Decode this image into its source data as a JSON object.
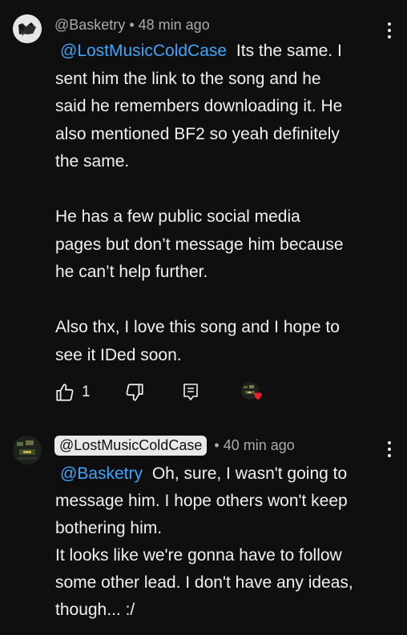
{
  "comments": [
    {
      "author": "@Basketry",
      "time": "48 min ago",
      "mention": "@LostMusicColdCase",
      "lines": [
        " Its the same. I",
        "sent him the link to the song and he",
        "said he remembers downloading it. He",
        "also mentioned BF2 so yeah definitely",
        "the same.",
        "",
        "He has a few public social media",
        "pages but don’t message him because",
        "he can’t help further.",
        "",
        "Also thx, I love this song and I hope to",
        "see it IDed soon."
      ],
      "like_count": "1"
    },
    {
      "author": "@LostMusicColdCase",
      "time": "40 min ago",
      "mention": "@Basketry",
      "lines": [
        " Oh, sure, I wasn't going to",
        "message him. I hope others won't keep",
        "bothering him.",
        "It looks like we're gonna have to follow",
        "some other lead. I don't have any ideas,",
        "though... :/"
      ]
    }
  ],
  "separator": "•",
  "icons": {
    "like": "thumbs-up-icon",
    "dislike": "thumbs-down-icon",
    "reply": "reply-icon",
    "more": "more-vert-icon",
    "creator_heart": "creator-heart-icon"
  },
  "colors": {
    "background": "#0f0f0f",
    "text": "#f1f1f1",
    "secondary": "#aaaaaa",
    "link": "#3ea6ff",
    "heart": "#e8212c"
  }
}
